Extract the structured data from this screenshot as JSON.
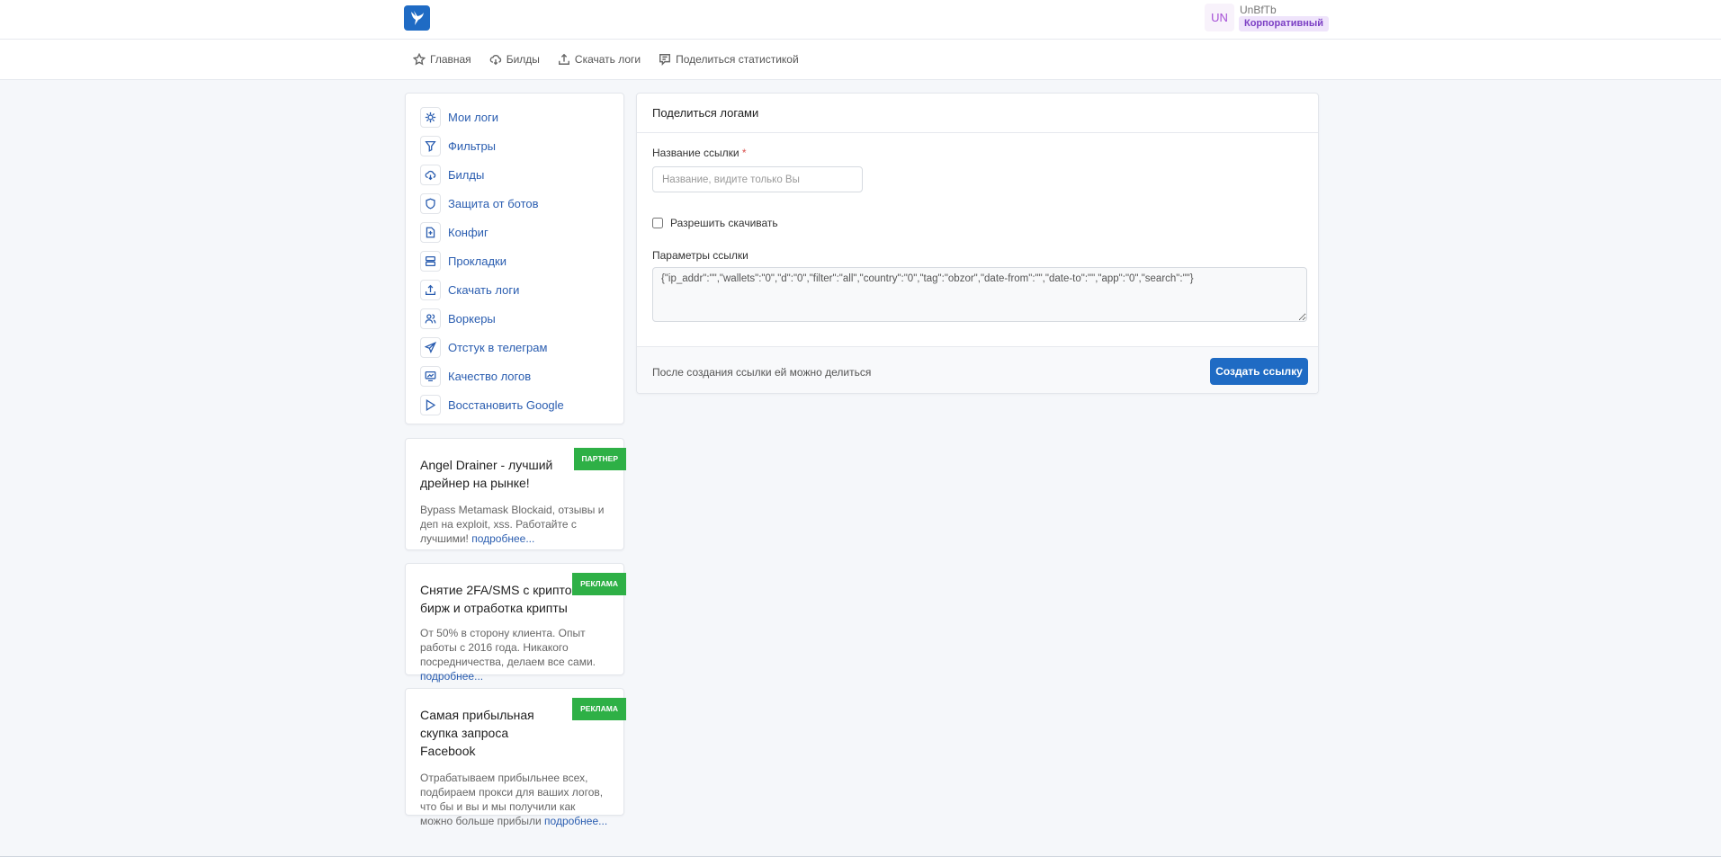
{
  "header": {
    "logo": "bird-logo",
    "user_initials": "UN",
    "username": "UnBfTb",
    "plan_badge": "Корпоративный"
  },
  "nav": [
    {
      "label": "Главная",
      "icon": "star-icon"
    },
    {
      "label": "Билды",
      "icon": "cloud-download-icon"
    },
    {
      "label": "Скачать логи",
      "icon": "upload-icon"
    },
    {
      "label": "Поделиться статистикой",
      "icon": "share-chat-icon"
    }
  ],
  "sidebar": {
    "items": [
      {
        "label": "Мои логи"
      },
      {
        "label": "Фильтры"
      },
      {
        "label": "Билды"
      },
      {
        "label": "Защита от ботов"
      },
      {
        "label": "Конфиг"
      },
      {
        "label": "Прокладки"
      },
      {
        "label": "Скачать логи"
      },
      {
        "label": "Воркеры"
      },
      {
        "label": "Отстук в телеграм"
      },
      {
        "label": "Качество логов"
      },
      {
        "label": "Восстановить Google"
      }
    ]
  },
  "form": {
    "title": "Поделиться логами",
    "name_label": "Название ссылки",
    "required_mark": "*",
    "name_placeholder": "Название, видите только Вы",
    "allow_download_label": "Разрешить скачивать",
    "params_label": "Параметры ссылки",
    "params_value": "{\"ip_addr\":\"\",\"wallets\":\"0\",\"d\":\"0\",\"filter\":\"all\",\"country\":\"0\",\"tag\":\"obzor\",\"date-from\":\"\",\"date-to\":\"\",\"app\":\"0\",\"search\":\"\"}",
    "footer_text": "После создания ссылки ей можно делиться",
    "submit_label": "Создать ссылку"
  },
  "ads": [
    {
      "badge": "ПАРТНЕР",
      "title": "Angel Drainer - лучший дрейнер на рынке!",
      "text": "Bypass Metamask Blockaid, отзывы и деп на exploit, xss. Работайте с лучшими! ",
      "link": "подробнее..."
    },
    {
      "badge": "РЕКЛАМА",
      "title": "Снятие 2FA/SMS с крипто-бирж и отработка крипты",
      "text": "От 50% в сторону клиента. Опыт работы с 2016 года. Никакого посредничества, делаем все сами. ",
      "link": "подробнее..."
    },
    {
      "badge": "РЕКЛАМА",
      "title": "Самая прибыльная скупка запроса Facebook",
      "text": "Отрабатываем прибыльнее всех, подбираем прокси для ваших логов, что бы и вы и мы получили как можно больше прибыли ",
      "link": "подробнее..."
    }
  ]
}
